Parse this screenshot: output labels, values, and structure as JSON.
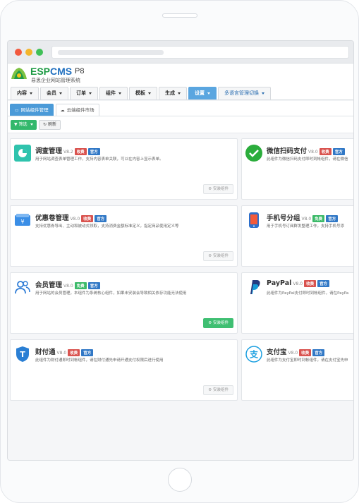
{
  "app": {
    "logo_esp": "ESP",
    "logo_cms": "CMS",
    "logo_version": "P8",
    "logo_subtitle": "易思企业网站管理系统"
  },
  "nav": [
    {
      "label": "内容"
    },
    {
      "label": "会员"
    },
    {
      "label": "订单"
    },
    {
      "label": "组件"
    },
    {
      "label": "模板"
    },
    {
      "label": "生成"
    },
    {
      "label": "设置",
      "active": true
    },
    {
      "label": "多语言管理切换"
    }
  ],
  "tabs": [
    {
      "label": "网站组件管理"
    },
    {
      "label": "云端组件市场"
    }
  ],
  "toolbar": {
    "filter_label": "筛选",
    "refresh_label": "刷新"
  },
  "cards": [
    {
      "title": "调查管理",
      "version": "V8.2",
      "badges": [
        "收费",
        "官方"
      ],
      "desc": "用于网站调查表单管理工作，支持内容表单关联，可以在内容上显示表单。",
      "install": "安装组件",
      "install_on": false,
      "icon": "pie-chart-icon"
    },
    {
      "title": "微信扫码支付",
      "version": "V8.0",
      "badges": [
        "收费",
        "官方"
      ],
      "desc": "此组件为微信扫码支付即时到帐组件，请在微信",
      "install": "",
      "install_on": false,
      "icon": "wechat-pay-icon"
    },
    {
      "title": "优惠卷管理",
      "version": "V8.0",
      "badges": [
        "收费",
        "官方"
      ],
      "desc": "支持优惠券导出、主动和被动式领取，支持消费金额标准定义，指定商品使用定义等",
      "install": "安装组件",
      "install_on": false,
      "icon": "coupon-icon"
    },
    {
      "title": "手机号分组",
      "version": "V8.0",
      "badges": [
        "免费",
        "官方"
      ],
      "desc": "用于手机号订阅群发整理工作，支持手机号添",
      "install": "",
      "install_on": false,
      "icon": "mobile-icon"
    },
    {
      "title": "会员管理",
      "version": "V8.0",
      "badges": [
        "免费",
        "官方"
      ],
      "desc": "用于网站的会员管理，本组件为系统核心组件，如果未安装会导致相关依存功能无法使用",
      "install": "安装组件",
      "install_on": true,
      "icon": "members-icon"
    },
    {
      "title": "PayPal",
      "version": "V8.0",
      "badges": [
        "收费",
        "官方"
      ],
      "desc": "此组件为PayPal支付即时到帐组件，请在PayPa",
      "install": "",
      "install_on": false,
      "icon": "paypal-icon"
    },
    {
      "title": "财付通",
      "version": "V8.0",
      "badges": [
        "收费",
        "官方"
      ],
      "desc": "此组件为财付通即时到帐组件，请在财付通先申请开通支付权限后进行使用",
      "install": "安装组件",
      "install_on": false,
      "icon": "tenpay-icon"
    },
    {
      "title": "支付宝",
      "version": "V8.0",
      "badges": [
        "收费",
        "官方"
      ],
      "desc": "此组件为支付宝即时到帐组件，请在支付宝先申",
      "install": "",
      "install_on": false,
      "icon": "alipay-icon"
    }
  ],
  "colors": {
    "primary": "#4a9ad8",
    "success": "#3fbf72",
    "danger": "#d9534f",
    "official": "#3178c6"
  }
}
